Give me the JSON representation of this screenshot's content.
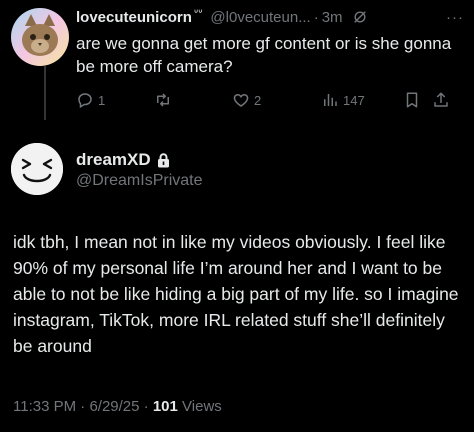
{
  "reply": {
    "display_name": "lovecuteunicorn",
    "name_decoration": "ᐡᐡ",
    "handle": "@l0vecuteun...",
    "separator": "·",
    "time": "3m",
    "more": "···",
    "text": "are we gonna get more gf content or is she gonna be more off camera?",
    "actions": {
      "reply_count": "1",
      "retweet_count": "",
      "like_count": "2",
      "view_count": "147"
    }
  },
  "tweet": {
    "display_name": "dreamXD",
    "handle": "@DreamIsPrivate",
    "body": "idk tbh, I mean not in like my videos obviously. I feel like 90% of my personal life I’m around her and I want to be able to not be like hiding a big part of my life. so I imagine instagram, TikTok, more IRL related stuff she’ll definitely be around",
    "time": "11:33 PM",
    "date": "6/29/25",
    "separator": "·",
    "views_count": "101",
    "views_label": "Views"
  },
  "colors": {
    "background": "#000000",
    "text": "#e7e9ea",
    "muted": "#71767b"
  },
  "icons": [
    "reply-icon",
    "retweet-icon",
    "like-icon",
    "views-icon",
    "bookmark-icon",
    "share-icon",
    "lock-icon",
    "grok-icon",
    "more-icon"
  ]
}
